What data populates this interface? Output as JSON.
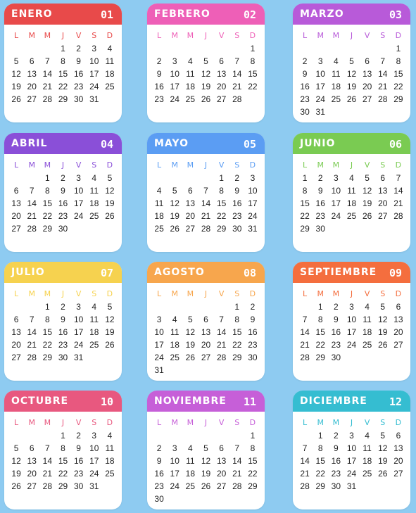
{
  "weekday_labels": [
    "L",
    "M",
    "M",
    "J",
    "V",
    "S",
    "D"
  ],
  "months": [
    {
      "name": "Enero",
      "number": "01",
      "color": "#e84a4a",
      "start": 3,
      "days": 31
    },
    {
      "name": "Febrero",
      "number": "02",
      "color": "#ee5fb7",
      "start": 6,
      "days": 28
    },
    {
      "name": "Marzo",
      "number": "03",
      "color": "#b85ad9",
      "start": 6,
      "days": 31
    },
    {
      "name": "Abril",
      "number": "04",
      "color": "#8a4fd8",
      "start": 2,
      "days": 30
    },
    {
      "name": "Mayo",
      "number": "05",
      "color": "#5b9df3",
      "start": 4,
      "days": 31
    },
    {
      "name": "Junio",
      "number": "06",
      "color": "#7acb52",
      "start": 0,
      "days": 30
    },
    {
      "name": "Julio",
      "number": "07",
      "color": "#f6d24f",
      "start": 2,
      "days": 31
    },
    {
      "name": "Agosto",
      "number": "08",
      "color": "#f7a64d",
      "start": 5,
      "days": 31
    },
    {
      "name": "Septiembre",
      "number": "09",
      "color": "#f46e3e",
      "start": 1,
      "days": 30
    },
    {
      "name": "Octubre",
      "number": "10",
      "color": "#e8587f",
      "start": 3,
      "days": 31
    },
    {
      "name": "Noviembre",
      "number": "11",
      "color": "#c65fd8",
      "start": 6,
      "days": 30
    },
    {
      "name": "Diciembre",
      "number": "12",
      "color": "#35bdd1",
      "start": 1,
      "days": 31
    }
  ]
}
